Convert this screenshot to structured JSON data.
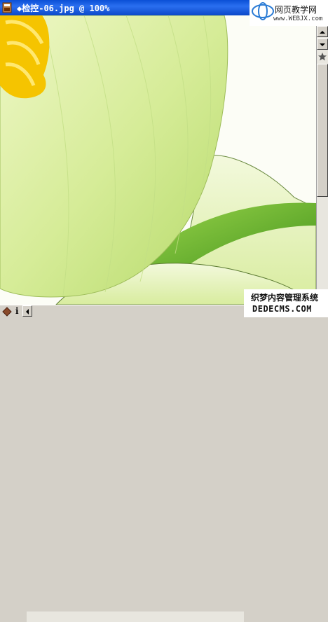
{
  "window": {
    "title": "◆检控-06.jpg @ 100%"
  },
  "watermark_top": {
    "line1": "网页教学网",
    "line2": "www.WEBJX.com"
  },
  "watermark_bottom": {
    "line1": "织梦内容管理系统",
    "line2": "DEDECMS.COM"
  },
  "status": {
    "info_glyph": "i"
  },
  "colors": {
    "titlebar": "#0a4fd6",
    "petal": "#d9ee9f",
    "stamen": "#f5c400",
    "leaf": "#5fae2a"
  },
  "icons": {
    "app": "document-icon",
    "star": "star-icon",
    "nav": "navigator-icon"
  }
}
